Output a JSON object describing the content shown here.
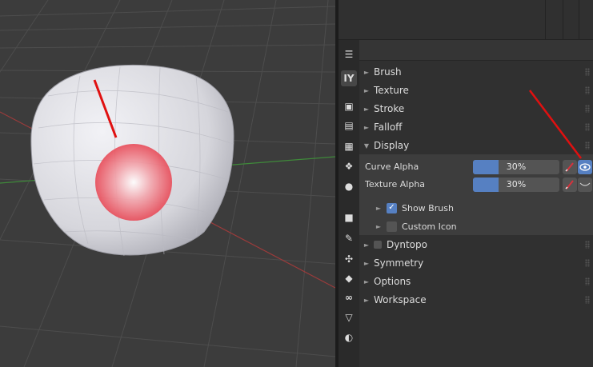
{
  "sections_top": [
    {
      "label": "Brush",
      "arrow": "►"
    },
    {
      "label": "Texture",
      "arrow": "►"
    },
    {
      "label": "Stroke",
      "arrow": "►"
    },
    {
      "label": "Falloff",
      "arrow": "►"
    },
    {
      "label": "Display",
      "arrow": "▼"
    }
  ],
  "display": {
    "curve_alpha": {
      "label": "Curve Alpha",
      "value": "30%",
      "fraction": 0.3
    },
    "texture_alpha": {
      "label": "Texture Alpha",
      "value": "30%",
      "fraction": 0.3
    },
    "show_brush": {
      "label": "Show Brush",
      "checked": true,
      "arrow": "►"
    },
    "custom_icon": {
      "label": "Custom Icon",
      "checked": false,
      "arrow": "►"
    }
  },
  "sections_bottom": [
    {
      "label": "Dyntopo",
      "arrow": "►",
      "has_checkbox": true
    },
    {
      "label": "Symmetry",
      "arrow": "►"
    },
    {
      "label": "Options",
      "arrow": "►"
    },
    {
      "label": "Workspace",
      "arrow": "►"
    }
  ],
  "tabs": [
    {
      "icon": "outliner-icon",
      "glyph": "☰"
    },
    {
      "icon": "tool-icon",
      "glyph": "IY"
    },
    {
      "icon": "render-icon",
      "glyph": "▣"
    },
    {
      "icon": "output-icon",
      "glyph": "▤"
    },
    {
      "icon": "view-layer-icon",
      "glyph": "▦"
    },
    {
      "icon": "scene-icon",
      "glyph": "❖"
    },
    {
      "icon": "world-icon",
      "glyph": "●"
    },
    {
      "icon": "object-icon",
      "glyph": "■"
    },
    {
      "icon": "modifier-icon",
      "glyph": "✎"
    },
    {
      "icon": "particles-icon",
      "glyph": "✣"
    },
    {
      "icon": "physics-icon",
      "glyph": "◆"
    },
    {
      "icon": "constraints-icon",
      "glyph": "∞"
    },
    {
      "icon": "data-icon",
      "glyph": "▽"
    },
    {
      "icon": "material-icon",
      "glyph": "◐"
    }
  ],
  "colors": {
    "accent": "#5680c2",
    "annotation_arrow": "#e01010",
    "brush_cursor": "#ee5a66"
  }
}
